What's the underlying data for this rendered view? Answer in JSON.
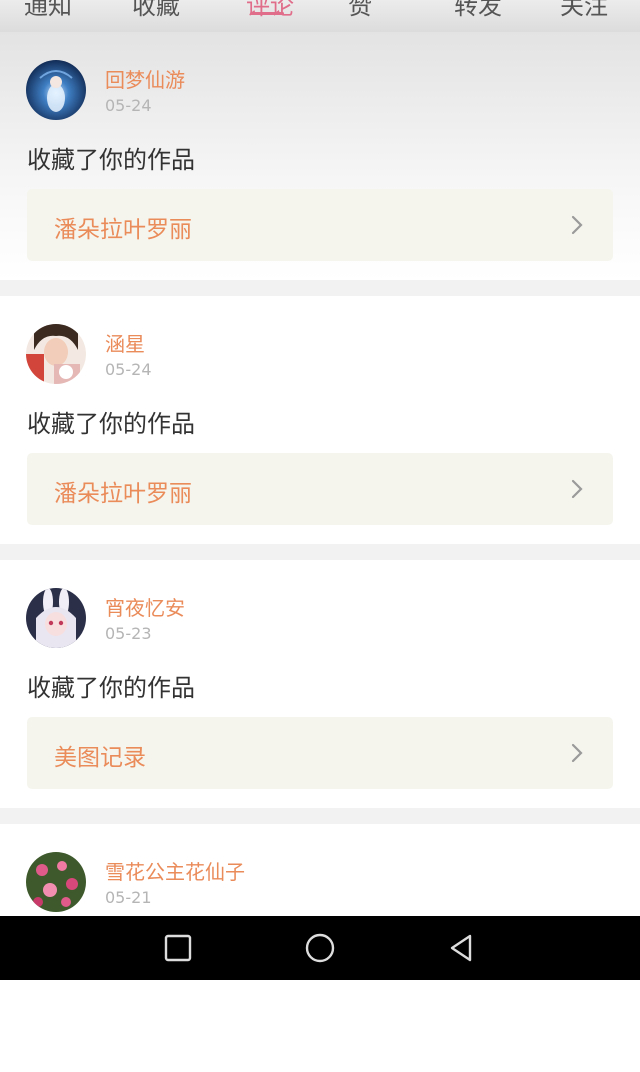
{
  "tabs": {
    "items": [
      "通知",
      "收藏",
      "评论",
      "赞",
      "转发",
      "关注"
    ],
    "active_index": 2,
    "accent_color": "#e06d8a"
  },
  "feed": [
    {
      "username": "回梦仙游",
      "date": "05-24",
      "action": "收藏了你的作品",
      "work_title": "潘朵拉叶罗丽",
      "avatar": "avatar-blue-fairy"
    },
    {
      "username": "涵星",
      "date": "05-24",
      "action": "收藏了你的作品",
      "work_title": "潘朵拉叶罗丽",
      "avatar": "avatar-girl-photo"
    },
    {
      "username": "宵夜忆安",
      "date": "05-23",
      "action": "收藏了你的作品",
      "work_title": "美图记录",
      "avatar": "avatar-anime-bunny"
    },
    {
      "username": "雪花公主花仙子",
      "date": "05-21",
      "action": "",
      "work_title": "",
      "avatar": "avatar-pink-flowers"
    }
  ],
  "colors": {
    "username": "#ea8b5a",
    "date": "#b5b5b5",
    "action_text": "#333333",
    "work_bg": "#f5f5ee"
  },
  "navbar": {
    "icons": [
      "recent-apps-icon",
      "home-icon",
      "back-icon"
    ]
  }
}
